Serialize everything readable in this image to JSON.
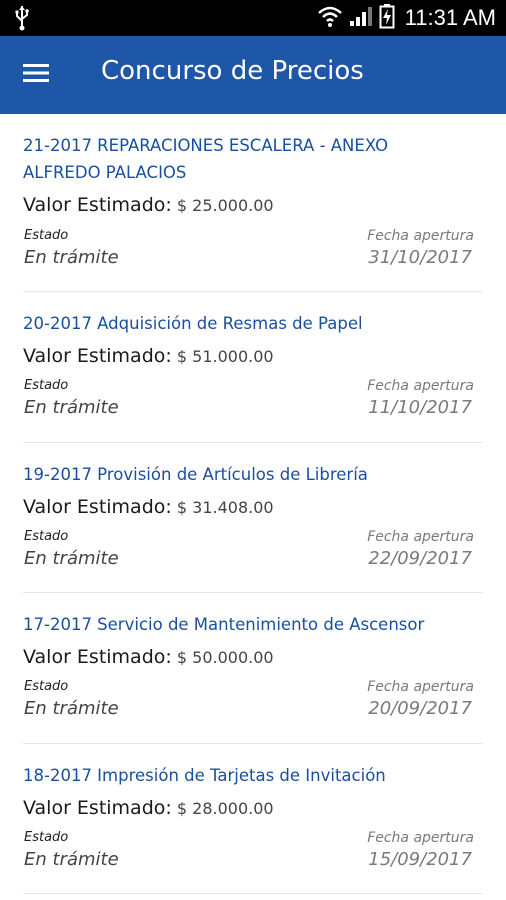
{
  "status_bar": {
    "time": "11:31 AM",
    "icons": [
      "usb-icon",
      "wifi-icon",
      "signal-icon",
      "battery-icon"
    ]
  },
  "app_bar": {
    "title": "Concurso de Precios",
    "menu_icon": "hamburger-menu-icon",
    "color": "#1e56a8"
  },
  "items": [
    {
      "title": "21-2017 REPARACIONES ESCALERA - ANEXO ALFREDO PALACIOS",
      "value_label": "Valor Estimado:",
      "value_amount": "$ 25.000.00",
      "estado_label": "Estado",
      "estado": "En trámite",
      "fecha_label": "Fecha apertura",
      "fecha": "31/10/2017"
    },
    {
      "title": "20-2017 Adquisición de Resmas de Papel",
      "value_label": "Valor Estimado:",
      "value_amount": "$ 51.000.00",
      "estado_label": "Estado",
      "estado": "En trámite",
      "fecha_label": "Fecha apertura",
      "fecha": "11/10/2017"
    },
    {
      "title": "19-2017 Provisión de Artículos de Librería",
      "value_label": "Valor Estimado:",
      "value_amount": "$ 31.408.00",
      "estado_label": "Estado",
      "estado": "En trámite",
      "fecha_label": "Fecha apertura",
      "fecha": "22/09/2017"
    },
    {
      "title": "17-2017 Servicio de Mantenimiento de Ascensor",
      "value_label": "Valor Estimado:",
      "value_amount": "$ 50.000.00",
      "estado_label": "Estado",
      "estado": "En trámite",
      "fecha_label": "Fecha apertura",
      "fecha": "20/09/2017"
    },
    {
      "title": "18-2017 Impresión de Tarjetas de Invitación",
      "value_label": "Valor Estimado:",
      "value_amount": "$ 28.000.00",
      "estado_label": "Estado",
      "estado": "En trámite",
      "fecha_label": "Fecha apertura",
      "fecha": "15/09/2017"
    }
  ]
}
